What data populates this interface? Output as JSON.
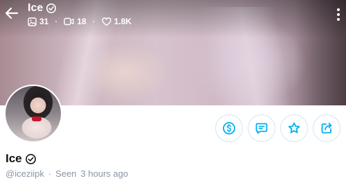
{
  "header": {
    "name": "Ice",
    "stats": {
      "photos": "31",
      "videos": "18",
      "likes": "1.8K"
    }
  },
  "profile": {
    "name": "Ice",
    "username": "@iceziipk",
    "seen_label": "Seen",
    "seen_time": "3 hours ago"
  },
  "colors": {
    "accent": "#00aff0",
    "muted": "#8a96a3",
    "button_border": "#d2e5f4"
  },
  "icons": {
    "back": "back-arrow-icon",
    "more": "more-vertical-icon",
    "verified": "verified-badge-icon",
    "photos": "image-icon",
    "videos": "video-icon",
    "likes": "heart-icon",
    "tip": "dollar-icon",
    "message": "message-icon",
    "favorite": "star-icon",
    "share": "share-icon"
  }
}
